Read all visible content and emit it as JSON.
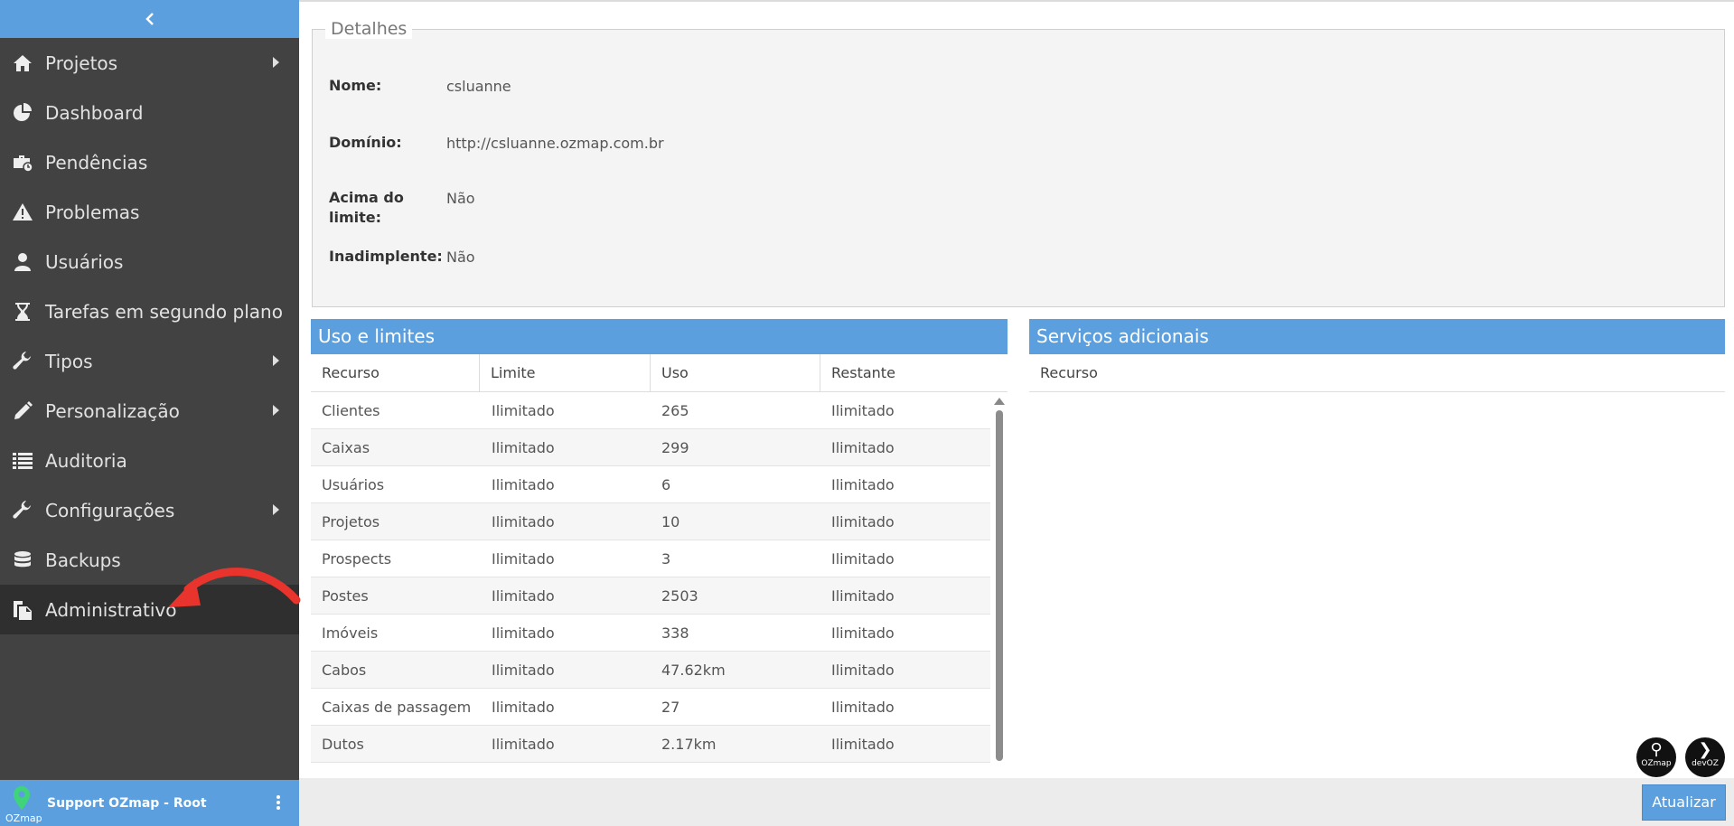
{
  "sidebar": {
    "collapse_label": "‹",
    "items": [
      {
        "label": "Projetos",
        "icon": "home-icon",
        "has_submenu": true
      },
      {
        "label": "Dashboard",
        "icon": "pie-chart-icon",
        "has_submenu": false
      },
      {
        "label": "Pendências",
        "icon": "briefcase-clock-icon",
        "has_submenu": false
      },
      {
        "label": "Problemas",
        "icon": "warning-icon",
        "has_submenu": false
      },
      {
        "label": "Usuários",
        "icon": "user-icon",
        "has_submenu": false
      },
      {
        "label": "Tarefas em segundo plano",
        "icon": "hourglass-icon",
        "has_submenu": false
      },
      {
        "label": "Tipos",
        "icon": "wrench-icon",
        "has_submenu": true
      },
      {
        "label": "Personalização",
        "icon": "pencil-icon",
        "has_submenu": true
      },
      {
        "label": "Auditoria",
        "icon": "list-icon",
        "has_submenu": false
      },
      {
        "label": "Configurações",
        "icon": "wrench-icon",
        "has_submenu": true
      },
      {
        "label": "Backups",
        "icon": "database-icon",
        "has_submenu": false
      },
      {
        "label": "Administrativo",
        "icon": "documents-icon",
        "has_submenu": false,
        "active": true
      }
    ],
    "footer": {
      "logo_text": "OZmap",
      "user_label": "Support OZmap - Root"
    }
  },
  "details": {
    "legend": "Detalhes",
    "nome_label": "Nome:",
    "nome_value": "csluanne",
    "dominio_label": "Domínio:",
    "dominio_value": "http://csluanne.ozmap.com.br",
    "acima_label_line1": "Acima do",
    "acima_label_line2": "limite:",
    "acima_value": "Não",
    "inadimplente_label": "Inadimplente:",
    "inadimplente_value": "Não"
  },
  "uso": {
    "title": "Uso e limites",
    "columns": [
      "Recurso",
      "Limite",
      "Uso",
      "Restante"
    ],
    "rows": [
      [
        "Clientes",
        "Ilimitado",
        "265",
        "Ilimitado"
      ],
      [
        "Caixas",
        "Ilimitado",
        "299",
        "Ilimitado"
      ],
      [
        "Usuários",
        "Ilimitado",
        "6",
        "Ilimitado"
      ],
      [
        "Projetos",
        "Ilimitado",
        "10",
        "Ilimitado"
      ],
      [
        "Prospects",
        "Ilimitado",
        "3",
        "Ilimitado"
      ],
      [
        "Postes",
        "Ilimitado",
        "2503",
        "Ilimitado"
      ],
      [
        "Imóveis",
        "Ilimitado",
        "338",
        "Ilimitado"
      ],
      [
        "Cabos",
        "Ilimitado",
        "47.62km",
        "Ilimitado"
      ],
      [
        "Caixas de passagem",
        "Ilimitado",
        "27",
        "Ilimitado"
      ],
      [
        "Dutos",
        "Ilimitado",
        "2.17km",
        "Ilimitado"
      ]
    ]
  },
  "servicos": {
    "title": "Serviços adicionais",
    "columns": [
      "Recurso"
    ]
  },
  "actions": {
    "update_label": "Atualizar"
  },
  "logos": {
    "ozmap": "OZmap",
    "devoz": "devOZ"
  },
  "colors": {
    "accent": "#5b9fdf",
    "sidebar_bg": "#424242",
    "sidebar_active": "#2f2f2f",
    "annotation_arrow": "#e8342c"
  }
}
